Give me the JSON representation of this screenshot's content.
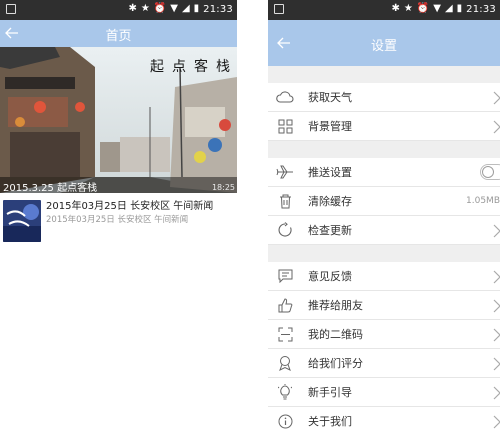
{
  "left": {
    "status_time": "21:33",
    "title": "首页",
    "hero": {
      "caption": "2015.3.25 起点客栈",
      "sign_text": "起点客栈",
      "timestamp": "18:25"
    },
    "news": [
      {
        "title": "2015年03月25日 长安校区 午间新闻",
        "subtitle": "2015年03月25日 长安校区 午间新闻"
      }
    ]
  },
  "right": {
    "status_time": "21:33",
    "title": "设置",
    "groups": [
      [
        {
          "label": "获取天气",
          "icon": "cloud-icon"
        },
        {
          "label": "背景管理",
          "icon": "grid-icon"
        }
      ],
      [
        {
          "label": "推送设置",
          "icon": "airplane-icon",
          "toggle": false
        },
        {
          "label": "清除缓存",
          "icon": "trash-icon",
          "value": "1.05MB"
        },
        {
          "label": "检查更新",
          "icon": "refresh-icon"
        }
      ],
      [
        {
          "label": "意见反馈",
          "icon": "feedback-icon"
        },
        {
          "label": "推荐给朋友",
          "icon": "thumbs-up-icon"
        },
        {
          "label": "我的二维码",
          "icon": "qr-icon"
        },
        {
          "label": "给我们评分",
          "icon": "award-icon"
        },
        {
          "label": "新手引导",
          "icon": "bulb-icon"
        },
        {
          "label": "关于我们",
          "icon": "info-icon"
        }
      ]
    ]
  },
  "colors": {
    "topbar": "#a9c7ea",
    "statusbar": "#2f2f2f",
    "group_gap": "#efefef"
  }
}
